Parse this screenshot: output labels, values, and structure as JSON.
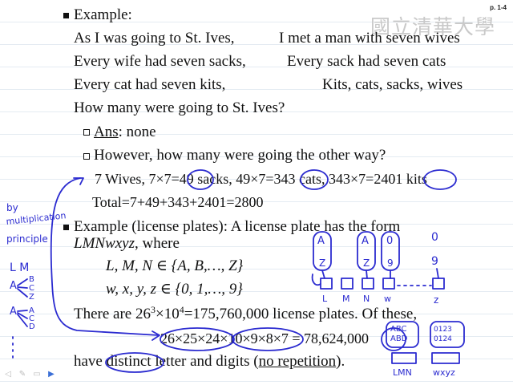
{
  "page_number": "p. 1-4",
  "logo_text": "國立清華大學",
  "ex1": {
    "heading": "Example:",
    "rhyme": [
      {
        "a": "As I was going to St. Ives,",
        "b": "I met a man with seven wives"
      },
      {
        "a": "Every wife had seven sacks,",
        "b": "Every sack had seven cats"
      },
      {
        "a": "Every cat had seven kits,",
        "b": "Kits, cats, sacks, wives"
      }
    ],
    "question": "How many were going to St. Ives?",
    "ans_label": "Ans",
    "ans_rest": ": none",
    "q2": "However, how many were going the other way?",
    "calc": "7 Wives, 7×7=49 sacks, 49×7=343 cats, 343×7=2401 kits",
    "total": "Total=7+49+343+2401=2800"
  },
  "ex2": {
    "heading": "Example (license plates): A license plate has the form",
    "form_var": "LMNwxyz",
    "form_rest": ", where",
    "set1": "L, M, N ∈ {A, B,…, Z}",
    "set2": "w, x, y, z ∈ {0, 1,…, 9}",
    "count_pre": "There are 26",
    "exp1": "3",
    "count_mid": "×10",
    "exp2": "4",
    "count_post": "=175,760,000 license plates. Of these,",
    "distinct_calc": "26×25×24×10×9×8×7 = 78,624,000",
    "last_pre": "have ",
    "distinct_word": "distinct",
    "last_mid": " letter and digits (",
    "no_rep": "no repetition",
    "last_post": ")."
  },
  "annotations": {
    "margin": [
      "by",
      "multiplication",
      "principle"
    ],
    "tree_top": "L M",
    "tree_nodes": [
      "A",
      "B",
      "C",
      "Z",
      "A",
      "C",
      "D"
    ],
    "letter_slots": [
      "A",
      "Z",
      "A",
      "Z",
      "0",
      "9",
      "0",
      "9"
    ],
    "slot_labels": [
      "L",
      "M",
      "N",
      "w",
      "z"
    ],
    "box_left_text": [
      "ABC",
      "ABD"
    ],
    "box_right_text": [
      "0123",
      "0124"
    ],
    "box_left_label": "LMN",
    "box_right_label": "wxyz"
  }
}
